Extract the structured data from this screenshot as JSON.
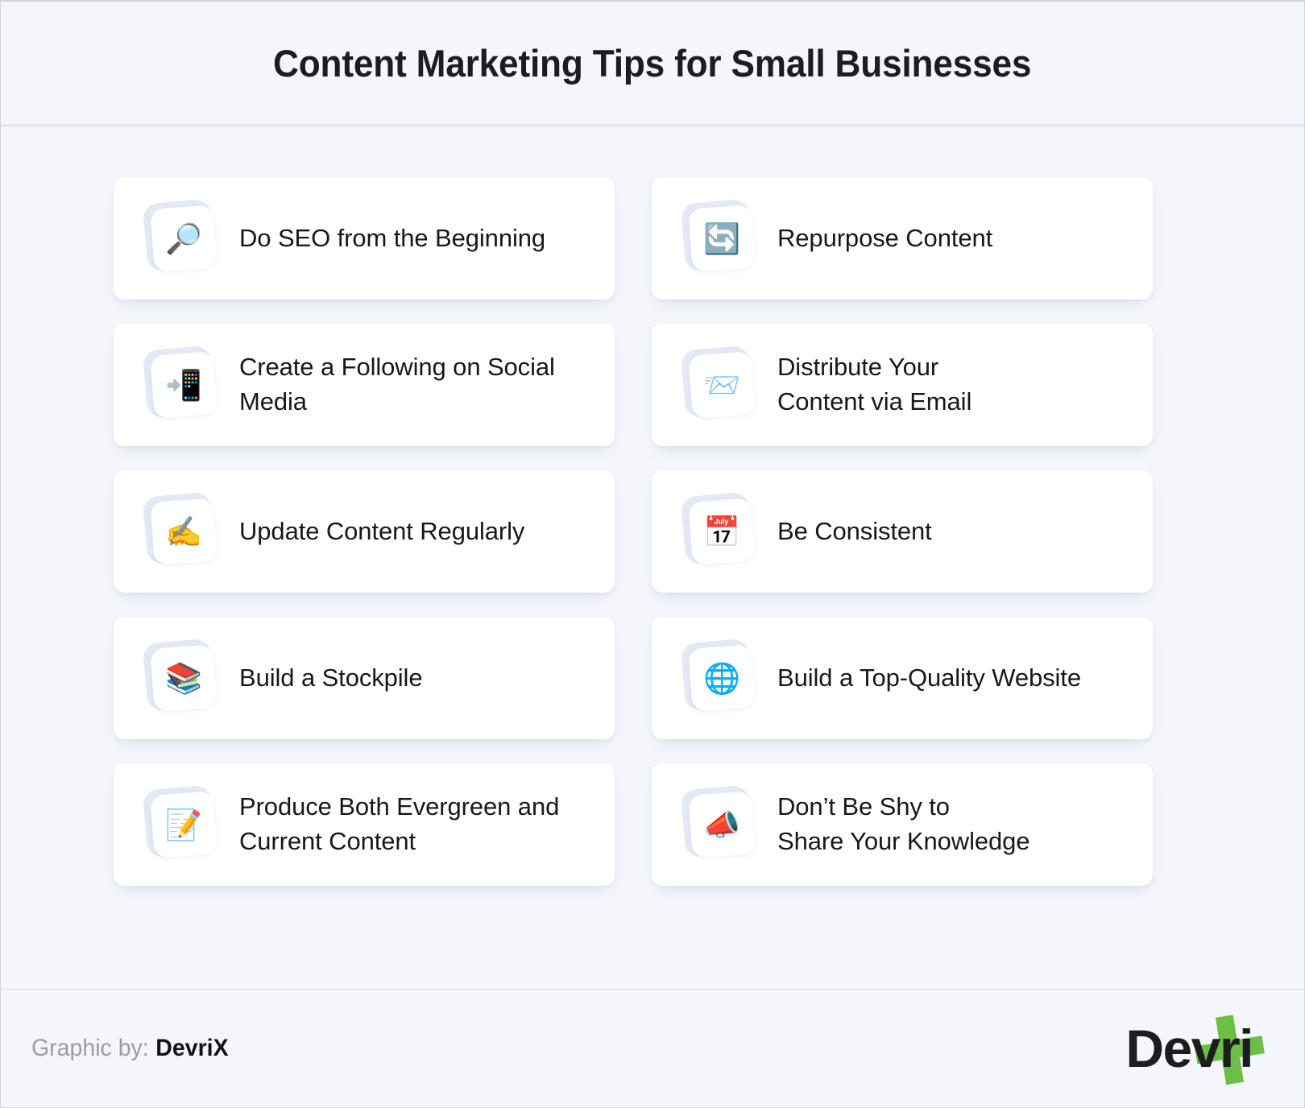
{
  "header": {
    "title": "Content Marketing Tips for Small Businesses"
  },
  "colors": {
    "background": "#F4F6FB",
    "card_background": "#FFFFFF",
    "divider": "#E3E7F3",
    "icon_tile_back": "#E4E9F6",
    "title_text": "#1D1D1F",
    "label_text": "#16181C",
    "credit_muted": "#9B9DA4",
    "brand_green": "#6CBE45"
  },
  "tips": {
    "left_column": [
      {
        "icon": "magnifying-glass-icon",
        "glyph": "🔎",
        "label": "Do SEO from the Beginning"
      },
      {
        "icon": "mobile-phone-with-arrow-icon",
        "glyph": "📲",
        "label": "Create a Following on Social\nMedia"
      },
      {
        "icon": "writing-hand-icon",
        "glyph": "✍️",
        "label": "Update Content Regularly"
      },
      {
        "icon": "books-icon",
        "glyph": "📚",
        "label": "Build a Stockpile"
      },
      {
        "icon": "memo-icon",
        "glyph": "📝",
        "label": "Produce Both Evergreen and\nCurrent Content"
      }
    ],
    "right_column": [
      {
        "icon": "counterclockwise-arrows-icon",
        "glyph": "🔄",
        "label": "Repurpose Content"
      },
      {
        "icon": "incoming-envelope-icon",
        "glyph": "📨",
        "label": "Distribute Your\nContent via Email"
      },
      {
        "icon": "spiral-calendar-icon",
        "glyph": "📅",
        "label": "Be Consistent"
      },
      {
        "icon": "globe-with-meridians-icon",
        "glyph": "🌐",
        "label": "Build a Top-Quality Website"
      },
      {
        "icon": "megaphone-icon",
        "glyph": "📣",
        "label": "Don’t Be Shy to\nShare Your Knowledge"
      }
    ]
  },
  "footer": {
    "credit_prefix": "Graphic by:",
    "credit_brand": "DevriX",
    "logo_word": "Devri",
    "logo_x_letter": "X"
  }
}
